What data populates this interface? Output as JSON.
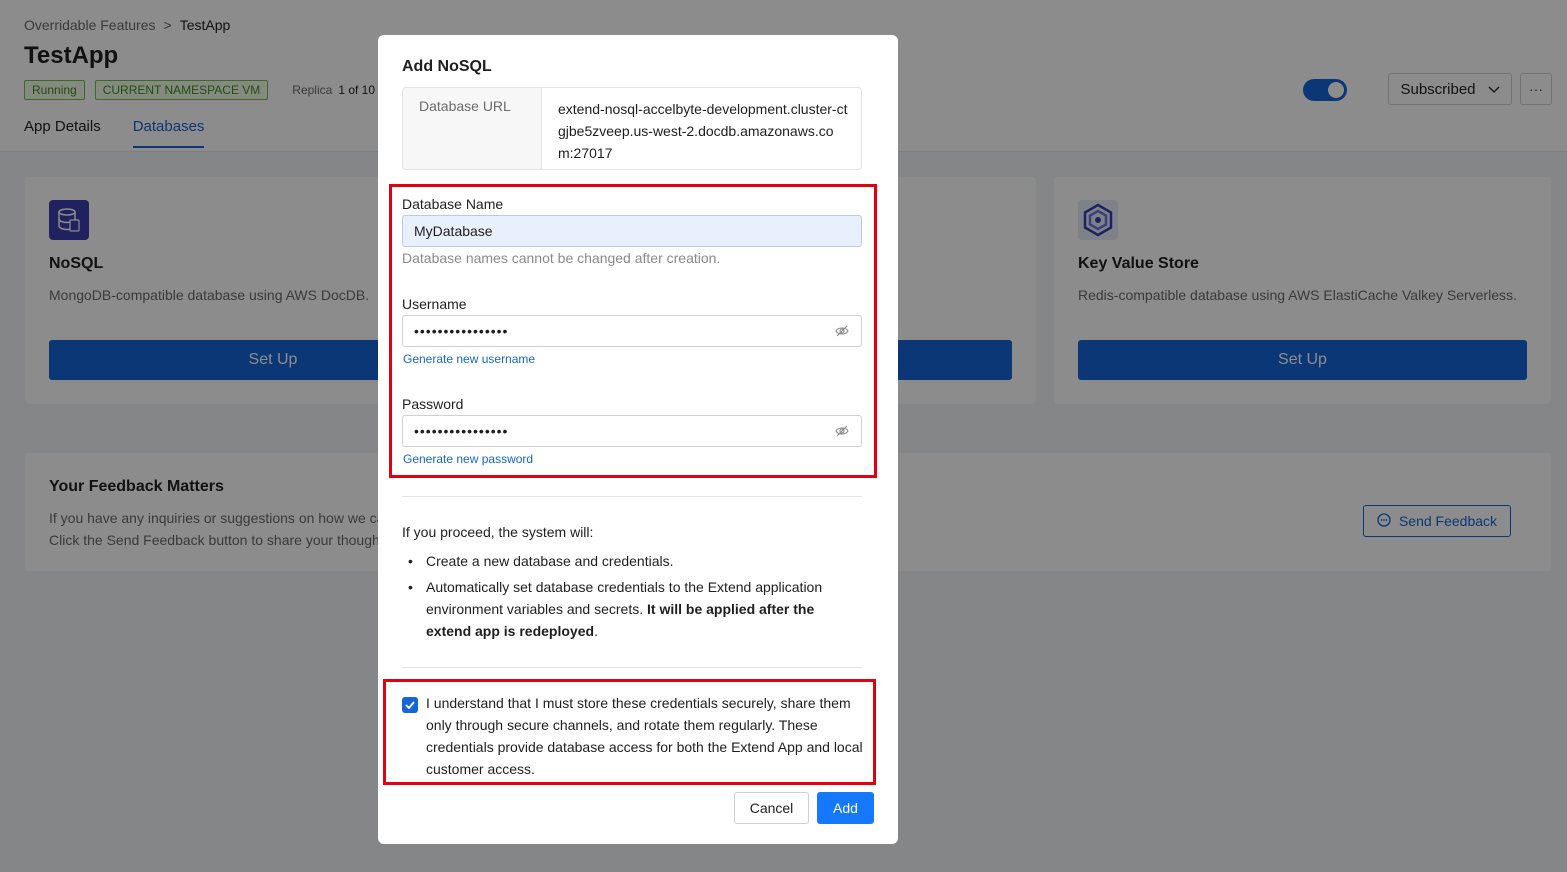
{
  "breadcrumb": {
    "parent": "Overridable Features",
    "separator": ">",
    "current": "TestApp"
  },
  "app": {
    "title": "TestApp",
    "status_badge": "Running",
    "namespace_badge": "CURRENT NAMESPACE VM",
    "replica_label": "Replica",
    "replica_value": "1 of 10"
  },
  "tabs": [
    {
      "label": "App Details",
      "active": false
    },
    {
      "label": "Databases",
      "active": true
    }
  ],
  "header_actions": {
    "subscribed_label": "Subscribed",
    "more_label": "···",
    "toggle_on": true
  },
  "cards": {
    "nosql": {
      "title": "NoSQL",
      "description": "MongoDB-compatible database using AWS DocDB.",
      "button": "Set Up"
    },
    "kv": {
      "title": "Key Value Store",
      "description": "Redis-compatible database using AWS ElastiCache Valkey Serverless.",
      "button": "Set Up"
    }
  },
  "feedback": {
    "title": "Your Feedback Matters",
    "line1": "If you have any inquiries or suggestions on how we ca",
    "line2": "Click the Send Feedback button to share your thought",
    "button": "Send Feedback"
  },
  "modal": {
    "title": "Add NoSQL",
    "url_label": "Database URL",
    "url_value": "extend-nosql-accelbyte-development.cluster-ctgjbe5zveep.us-west-2.docdb.amazonaws.com:27017",
    "db_name_label": "Database Name",
    "db_name_value": "MyDatabase",
    "db_name_hint": "Database names cannot be changed after creation.",
    "username_label": "Username",
    "username_value": "••••••••••••••••",
    "username_link": "Generate new username",
    "password_label": "Password",
    "password_value": "••••••••••••••••",
    "password_link": "Generate new password",
    "proceed_intro": "If you proceed, the system will:",
    "proceed_item1": "Create a new database and credentials.",
    "proceed_item2_prefix": "Automatically set database credentials to the Extend application environment variables and secrets. ",
    "proceed_item2_bold": "It will be applied after the extend app is redeployed",
    "proceed_item2_suffix": ".",
    "checkbox_checked": true,
    "checkbox_text": "I understand that I must store these credentials securely, share them only through secure channels, and rotate them regularly. These credentials provide database access for both the Extend App and local customer access.",
    "cancel_label": "Cancel",
    "add_label": "Add"
  },
  "colors": {
    "accent": "#1565d8",
    "primary_button": "#1677ff",
    "highlight": "#e5000f",
    "running": "#6cc04a"
  }
}
